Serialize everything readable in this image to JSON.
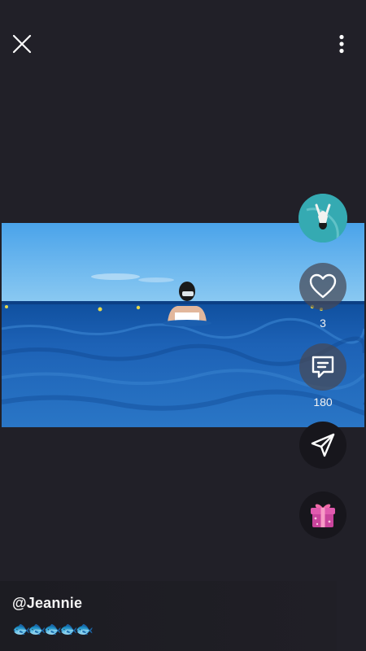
{
  "app": {
    "close_icon": "close-icon",
    "more_icon": "more-vertical-icon"
  },
  "video": {
    "subject": "person snorkeling in the open sea"
  },
  "rail": {
    "avatar_icon": "avatar",
    "like_icon": "heart-outline-icon",
    "like_count": "3",
    "comment_icon": "comment-icon",
    "comment_count": "180",
    "share_icon": "send-icon",
    "gift_icon": "gift-icon"
  },
  "post": {
    "username": "@Jeannie",
    "caption": "🐟🐟🐟🐟🐟"
  },
  "colors": {
    "background": "#212028",
    "sea": "#1f63b4",
    "sky": "#5fb0ea",
    "gift_box": "#d64ea6",
    "gift_ribbon": "#f06aa8"
  }
}
